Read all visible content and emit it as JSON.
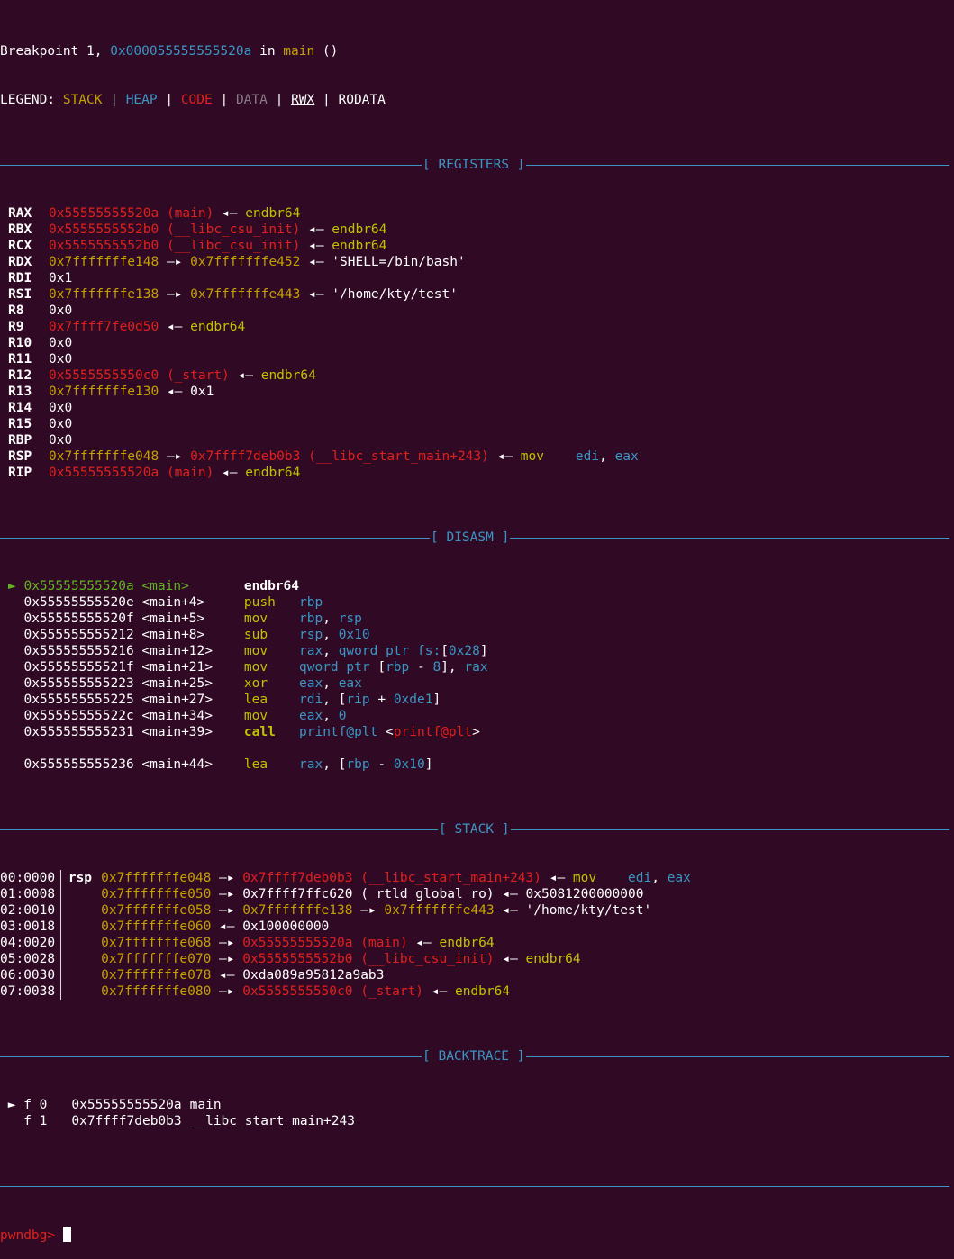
{
  "breakpoint": {
    "prefix": "Breakpoint 1, ",
    "addr": "0x000055555555520a",
    "in": " in ",
    "func": "main",
    "suffix": " ()"
  },
  "legend": {
    "label": "LEGEND: ",
    "stack": "STACK",
    "sep": " | ",
    "heap": "HEAP",
    "code": "CODE",
    "data": "DATA",
    "rwx": "RWX",
    "rodata": "RODATA"
  },
  "sections": {
    "registers": "[ REGISTERS ]",
    "disasm": "[ DISASM ]",
    "stack": "[ STACK ]",
    "backtrace": "[ BACKTRACE ]"
  },
  "registers": [
    {
      "name": "RAX",
      "v1": "0x55555555520a",
      "v1c": "red",
      "sym": " (main)",
      "chain": [
        {
          "arrow": " ◂— ",
          "text": "endbr64",
          "c": "olive"
        }
      ]
    },
    {
      "name": "RBX",
      "v1": "0x5555555552b0",
      "v1c": "red",
      "sym": " (__libc_csu_init)",
      "chain": [
        {
          "arrow": " ◂— ",
          "text": "endbr64",
          "c": "olive"
        }
      ]
    },
    {
      "name": "RCX",
      "v1": "0x5555555552b0",
      "v1c": "red",
      "sym": " (__libc_csu_init)",
      "chain": [
        {
          "arrow": " ◂— ",
          "text": "endbr64",
          "c": "olive"
        }
      ]
    },
    {
      "name": "RDX",
      "v1": "0x7fffffffe148",
      "v1c": "yellow",
      "sym": "",
      "chain": [
        {
          "arrow": " —▸ ",
          "text": "0x7fffffffe452",
          "c": "yellow"
        },
        {
          "arrow": " ◂— ",
          "text": "'SHELL=/bin/bash'",
          "c": "white"
        }
      ]
    },
    {
      "name": "RDI",
      "v1": "0x1",
      "v1c": "white",
      "sym": "",
      "chain": []
    },
    {
      "name": "RSI",
      "v1": "0x7fffffffe138",
      "v1c": "yellow",
      "sym": "",
      "chain": [
        {
          "arrow": " —▸ ",
          "text": "0x7fffffffe443",
          "c": "yellow"
        },
        {
          "arrow": " ◂— ",
          "text": "'/home/kty/test'",
          "c": "white"
        }
      ]
    },
    {
      "name": "R8",
      "v1": "0x0",
      "v1c": "white",
      "sym": "",
      "chain": []
    },
    {
      "name": "R9",
      "v1": "0x7ffff7fe0d50",
      "v1c": "red",
      "sym": "",
      "chain": [
        {
          "arrow": " ◂— ",
          "text": "endbr64",
          "c": "olive"
        }
      ]
    },
    {
      "name": "R10",
      "v1": "0x0",
      "v1c": "white",
      "sym": "",
      "chain": []
    },
    {
      "name": "R11",
      "v1": "0x0",
      "v1c": "white",
      "sym": "",
      "chain": []
    },
    {
      "name": "R12",
      "v1": "0x5555555550c0",
      "v1c": "red",
      "sym": " (_start)",
      "chain": [
        {
          "arrow": " ◂— ",
          "text": "endbr64",
          "c": "olive"
        }
      ]
    },
    {
      "name": "R13",
      "v1": "0x7fffffffe130",
      "v1c": "yellow",
      "sym": "",
      "chain": [
        {
          "arrow": " ◂— ",
          "text": "0x1",
          "c": "white"
        }
      ]
    },
    {
      "name": "R14",
      "v1": "0x0",
      "v1c": "white",
      "sym": "",
      "chain": []
    },
    {
      "name": "R15",
      "v1": "0x0",
      "v1c": "white",
      "sym": "",
      "chain": []
    },
    {
      "name": "RBP",
      "v1": "0x0",
      "v1c": "white",
      "sym": "",
      "chain": []
    },
    {
      "name": "RSP",
      "v1": "0x7fffffffe048",
      "v1c": "yellow",
      "sym": "",
      "chain": [
        {
          "arrow": " —▸ ",
          "text": "0x7ffff7deb0b3",
          "c": "red"
        },
        {
          "arrow": "",
          "text": " (__libc_start_main+243)",
          "c": "red"
        },
        {
          "arrow": " ◂— ",
          "text": "mov    ",
          "c": "olive"
        },
        {
          "arrow": "",
          "text": "edi",
          "c": "blue"
        },
        {
          "arrow": "",
          "text": ", ",
          "c": "white"
        },
        {
          "arrow": "",
          "text": "eax",
          "c": "blue"
        }
      ]
    },
    {
      "name": "RIP",
      "v1": "0x55555555520a",
      "v1c": "red",
      "sym": " (main)",
      "chain": [
        {
          "arrow": " ◂— ",
          "text": "endbr64",
          "c": "olive"
        }
      ]
    }
  ],
  "disasm": [
    {
      "marker": "► ",
      "addr": "0x55555555520a",
      "sym": " <main>       ",
      "mn": "endbr64",
      "ops": [],
      "current": true
    },
    {
      "marker": "  ",
      "addr": "0x55555555520e",
      "sym": " <main+4>     ",
      "mn": "push   ",
      "ops": [
        {
          "t": "rbp",
          "c": "blue"
        }
      ]
    },
    {
      "marker": "  ",
      "addr": "0x55555555520f",
      "sym": " <main+5>     ",
      "mn": "mov    ",
      "ops": [
        {
          "t": "rbp",
          "c": "blue"
        },
        {
          "t": ", ",
          "c": "white"
        },
        {
          "t": "rsp",
          "c": "blue"
        }
      ]
    },
    {
      "marker": "  ",
      "addr": "0x555555555212",
      "sym": " <main+8>     ",
      "mn": "sub    ",
      "ops": [
        {
          "t": "rsp",
          "c": "blue"
        },
        {
          "t": ", ",
          "c": "white"
        },
        {
          "t": "0x10",
          "c": "blue"
        }
      ]
    },
    {
      "marker": "  ",
      "addr": "0x555555555216",
      "sym": " <main+12>    ",
      "mn": "mov    ",
      "ops": [
        {
          "t": "rax",
          "c": "blue"
        },
        {
          "t": ", ",
          "c": "white"
        },
        {
          "t": "qword ptr fs:",
          "c": "blue"
        },
        {
          "t": "[",
          "c": "white"
        },
        {
          "t": "0x28",
          "c": "blue"
        },
        {
          "t": "]",
          "c": "white"
        }
      ]
    },
    {
      "marker": "  ",
      "addr": "0x55555555521f",
      "sym": " <main+21>    ",
      "mn": "mov    ",
      "ops": [
        {
          "t": "qword ptr ",
          "c": "blue"
        },
        {
          "t": "[",
          "c": "white"
        },
        {
          "t": "rbp",
          "c": "blue"
        },
        {
          "t": " - ",
          "c": "white"
        },
        {
          "t": "8",
          "c": "blue"
        },
        {
          "t": "], ",
          "c": "white"
        },
        {
          "t": "rax",
          "c": "blue"
        }
      ]
    },
    {
      "marker": "  ",
      "addr": "0x555555555223",
      "sym": " <main+25>    ",
      "mn": "xor    ",
      "ops": [
        {
          "t": "eax",
          "c": "blue"
        },
        {
          "t": ", ",
          "c": "white"
        },
        {
          "t": "eax",
          "c": "blue"
        }
      ]
    },
    {
      "marker": "  ",
      "addr": "0x555555555225",
      "sym": " <main+27>    ",
      "mn": "lea    ",
      "ops": [
        {
          "t": "rdi",
          "c": "blue"
        },
        {
          "t": ", [",
          "c": "white"
        },
        {
          "t": "rip",
          "c": "blue"
        },
        {
          "t": " + ",
          "c": "white"
        },
        {
          "t": "0xde1",
          "c": "blue"
        },
        {
          "t": "]",
          "c": "white"
        }
      ]
    },
    {
      "marker": "  ",
      "addr": "0x55555555522c",
      "sym": " <main+34>    ",
      "mn": "mov    ",
      "ops": [
        {
          "t": "eax",
          "c": "blue"
        },
        {
          "t": ", ",
          "c": "white"
        },
        {
          "t": "0",
          "c": "blue"
        }
      ]
    },
    {
      "marker": "  ",
      "addr": "0x555555555231",
      "sym": " <main+39>    ",
      "mn": "call   ",
      "ops": [
        {
          "t": "printf@plt",
          "c": "blue"
        },
        {
          "t": " <",
          "c": "white"
        },
        {
          "t": "printf@plt",
          "c": "red"
        },
        {
          "t": ">",
          "c": "white"
        }
      ],
      "bold": true
    },
    {
      "blank": true
    },
    {
      "marker": "  ",
      "addr": "0x555555555236",
      "sym": " <main+44>    ",
      "mn": "lea    ",
      "ops": [
        {
          "t": "rax",
          "c": "blue"
        },
        {
          "t": ", [",
          "c": "white"
        },
        {
          "t": "rbp",
          "c": "blue"
        },
        {
          "t": " - ",
          "c": "white"
        },
        {
          "t": "0x10",
          "c": "blue"
        },
        {
          "t": "]",
          "c": "white"
        }
      ]
    }
  ],
  "stack": [
    {
      "idx": "00:0000",
      "reg": "rsp",
      "addr": "0x7fffffffe048",
      "chain": [
        {
          "t": " —▸ ",
          "c": "white"
        },
        {
          "t": "0x7ffff7deb0b3",
          "c": "red"
        },
        {
          "t": " (__libc_start_main+243)",
          "c": "red"
        },
        {
          "t": " ◂— ",
          "c": "white"
        },
        {
          "t": "mov    ",
          "c": "olive"
        },
        {
          "t": "edi",
          "c": "blue"
        },
        {
          "t": ", ",
          "c": "white"
        },
        {
          "t": "eax",
          "c": "blue"
        }
      ]
    },
    {
      "idx": "01:0008",
      "reg": "",
      "addr": "0x7fffffffe050",
      "chain": [
        {
          "t": " —▸ ",
          "c": "white"
        },
        {
          "t": "0x7ffff7ffc620 (_rtld_global_ro)",
          "c": "white"
        },
        {
          "t": " ◂— ",
          "c": "white"
        },
        {
          "t": "0x5081200000000",
          "c": "white"
        }
      ]
    },
    {
      "idx": "02:0010",
      "reg": "",
      "addr": "0x7fffffffe058",
      "chain": [
        {
          "t": " —▸ ",
          "c": "white"
        },
        {
          "t": "0x7fffffffe138",
          "c": "yellow"
        },
        {
          "t": " —▸ ",
          "c": "white"
        },
        {
          "t": "0x7fffffffe443",
          "c": "yellow"
        },
        {
          "t": " ◂— ",
          "c": "white"
        },
        {
          "t": "'/home/kty/test'",
          "c": "white"
        }
      ]
    },
    {
      "idx": "03:0018",
      "reg": "",
      "addr": "0x7fffffffe060",
      "chain": [
        {
          "t": " ◂— ",
          "c": "white"
        },
        {
          "t": "0x100000000",
          "c": "white"
        }
      ]
    },
    {
      "idx": "04:0020",
      "reg": "",
      "addr": "0x7fffffffe068",
      "chain": [
        {
          "t": " —▸ ",
          "c": "white"
        },
        {
          "t": "0x55555555520a",
          "c": "red"
        },
        {
          "t": " (main)",
          "c": "red"
        },
        {
          "t": " ◂— ",
          "c": "white"
        },
        {
          "t": "endbr64",
          "c": "olive"
        }
      ]
    },
    {
      "idx": "05:0028",
      "reg": "",
      "addr": "0x7fffffffe070",
      "chain": [
        {
          "t": " —▸ ",
          "c": "white"
        },
        {
          "t": "0x5555555552b0",
          "c": "red"
        },
        {
          "t": " (__libc_csu_init)",
          "c": "red"
        },
        {
          "t": " ◂— ",
          "c": "white"
        },
        {
          "t": "endbr64",
          "c": "olive"
        }
      ]
    },
    {
      "idx": "06:0030",
      "reg": "",
      "addr": "0x7fffffffe078",
      "chain": [
        {
          "t": " ◂— ",
          "c": "white"
        },
        {
          "t": "0xda089a95812a9ab3",
          "c": "white"
        }
      ]
    },
    {
      "idx": "07:0038",
      "reg": "",
      "addr": "0x7fffffffe080",
      "chain": [
        {
          "t": " —▸ ",
          "c": "white"
        },
        {
          "t": "0x5555555550c0",
          "c": "red"
        },
        {
          "t": " (_start)",
          "c": "red"
        },
        {
          "t": " ◂— ",
          "c": "white"
        },
        {
          "t": "endbr64",
          "c": "olive"
        }
      ]
    }
  ],
  "backtrace": [
    {
      "marker": " ► ",
      "frame": "f 0",
      "addr": "0x55555555520a",
      "func": "main"
    },
    {
      "marker": "   ",
      "frame": "f 1",
      "addr": "0x7ffff7deb0b3",
      "func": "__libc_start_main+243"
    }
  ],
  "prompt": "pwndbg> "
}
